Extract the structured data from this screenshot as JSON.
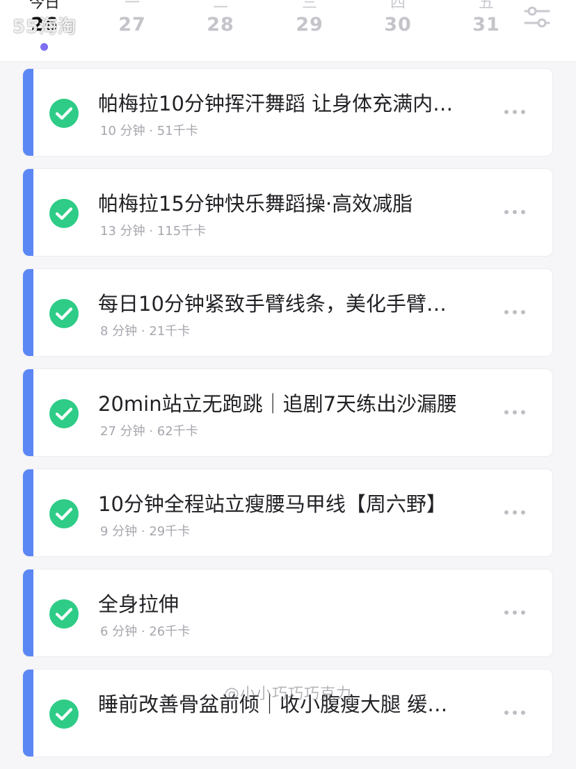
{
  "header": {
    "watermark": "55海淘",
    "days": [
      {
        "weekday": "今日",
        "num": "26",
        "active": true
      },
      {
        "weekday": "一",
        "num": "27",
        "active": false
      },
      {
        "weekday": "二",
        "num": "28",
        "active": false
      },
      {
        "weekday": "三",
        "num": "29",
        "active": false
      },
      {
        "weekday": "四",
        "num": "30",
        "active": false
      },
      {
        "weekday": "五",
        "num": "31",
        "active": false
      }
    ],
    "filter_icon": "sliders-icon"
  },
  "workouts": [
    {
      "title": "帕梅拉10分钟挥汗舞蹈 让身体充满内…",
      "meta": "10 分钟 · 51千卡",
      "status_icon": "check-circle-icon"
    },
    {
      "title": "帕梅拉15分钟快乐舞蹈操·高效减脂",
      "meta": "13 分钟 · 115千卡",
      "status_icon": "check-circle-icon"
    },
    {
      "title": "每日10分钟紧致手臂线条，美化手臂…",
      "meta": "8 分钟 · 21千卡",
      "status_icon": "check-circle-icon"
    },
    {
      "title": "20min站立无跑跳｜追剧7天练出沙漏腰",
      "meta": "27 分钟 · 62千卡",
      "status_icon": "check-circle-icon"
    },
    {
      "title": "10分钟全程站立瘦腰马甲线【周六野】",
      "meta": "9 分钟 · 29千卡",
      "status_icon": "check-circle-icon"
    },
    {
      "title": "全身拉伸",
      "meta": "6 分钟 · 26千卡",
      "status_icon": "check-circle-icon"
    },
    {
      "title": "睡前改善骨盆前倾｜收小腹瘦大腿 缓…",
      "meta": "",
      "status_icon": "check-circle-icon"
    }
  ],
  "watermark_bottom": "@小小巧巧巧克力",
  "colors": {
    "accent_bar": "#5b87f5",
    "check_green": "#2ecc86",
    "active_dot": "#7d6ff0"
  }
}
